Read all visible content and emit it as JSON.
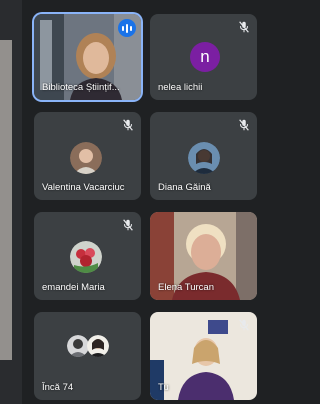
{
  "participants": [
    {
      "name": "Biblioteca Științif...",
      "speaking": true
    },
    {
      "name": "nelea lichii",
      "initial": "n",
      "avatar_color": "#7b1fa2"
    },
    {
      "name": "Valentina Vacarciuc"
    },
    {
      "name": "Diana Găină"
    },
    {
      "name": "emandei Maria"
    },
    {
      "name": "Elena Turcan"
    },
    {
      "name": "Încă 74"
    },
    {
      "name": "Tu"
    }
  ],
  "colors": {
    "tile_bg": "#3c4043",
    "page_bg": "#1f2123",
    "speaking_accent": "#1a73e8"
  }
}
